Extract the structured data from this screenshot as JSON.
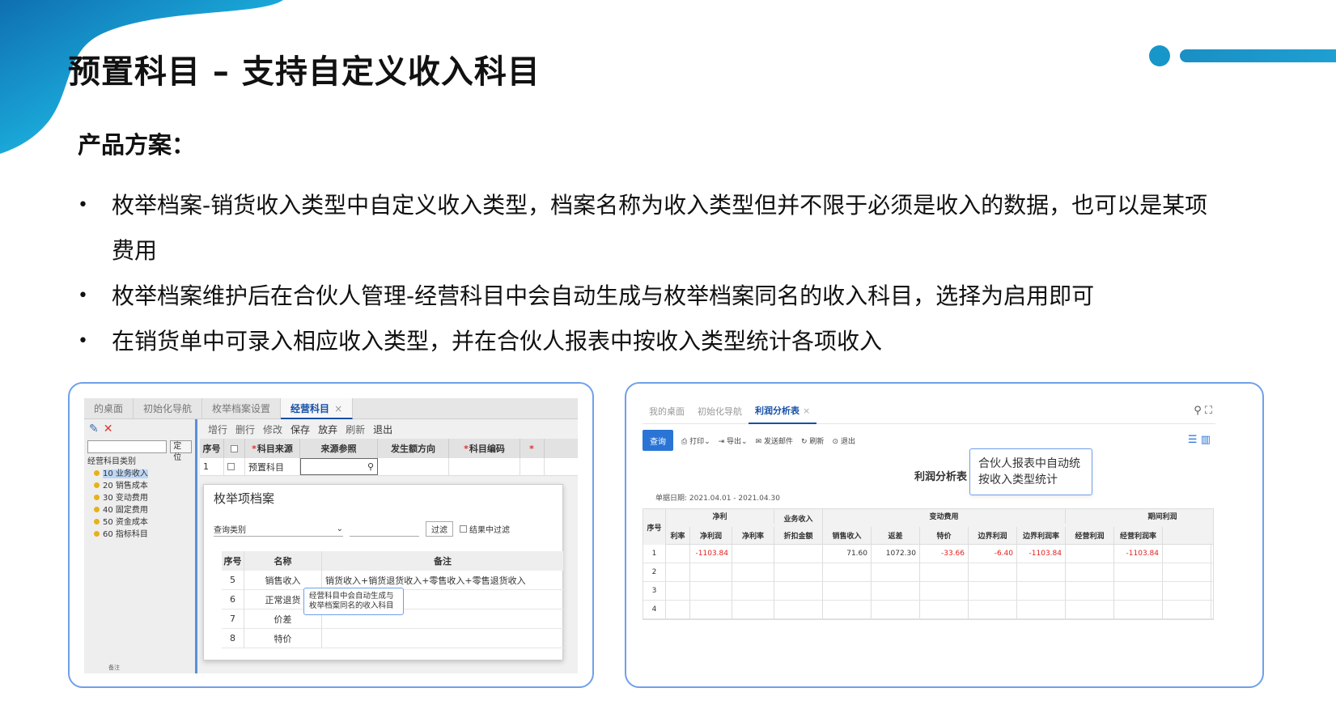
{
  "slide": {
    "title": "预置科目 – 支持自定义收入科目",
    "subtitle": "产品方案：",
    "bullet_symbol": "•",
    "bullets": [
      "枚举档案-销货收入类型中自定义收入类型，档案名称为收入类型但并不限于必须是收入的数据，也可以是某项费用",
      "枚举档案维护后在合伙人管理-经营科目中会自动生成与枚举档案同名的收入科目，选择为启用即可",
      "在销货单中可录入相应收入类型，并在合伙人报表中按收入类型统计各项收入"
    ],
    "colors": {
      "accent": "#1797c9",
      "frame_border": "#6fa0e8",
      "link_blue": "#1750a8",
      "negative": "#e02020"
    }
  },
  "left_app": {
    "tabs": [
      "的桌面",
      "初始化导航",
      "枚举档案设置",
      "经营科目"
    ],
    "close_symbol": "×",
    "sidebar": {
      "tool_icons": [
        "edit-icon",
        "delete-icon"
      ],
      "locate_button": "定位",
      "tree_root": "经营科目类别",
      "tree_items": [
        "10 业务收入",
        "20 销售成本",
        "30 变动费用",
        "40 固定费用",
        "50 资金成本",
        "60 指标科目"
      ],
      "status": "备注"
    },
    "toolbar": [
      "增行",
      "删行",
      "修改",
      "保存",
      "放弃",
      "刷新",
      "退出"
    ],
    "grid_headers": [
      "序号",
      "",
      "科目来源",
      "来源参照",
      "发生额方向",
      "科目编码",
      ""
    ],
    "required_mark": "*",
    "grid_row": {
      "seq": "1",
      "source": "预置科目"
    },
    "dialog": {
      "title": "枚举项档案",
      "query_label": "查询类别",
      "filter_button": "过滤",
      "filter_checkbox": "结果中过滤",
      "headers": [
        "序号",
        "名称",
        "备注"
      ],
      "rows": [
        {
          "seq": "5",
          "name": "销售收入",
          "remark": "销货收入+销货退货收入+零售收入+零售退货收入"
        },
        {
          "seq": "6",
          "name": "正常退货",
          "remark": ""
        },
        {
          "seq": "7",
          "name": "价差",
          "remark": ""
        },
        {
          "seq": "8",
          "name": "特价",
          "remark": ""
        }
      ]
    },
    "tooltip": "经营科目中会自动生成与枚举档案同名的收入科目"
  },
  "right_app": {
    "tabs": [
      "我的桌面",
      "初始化导航",
      "利润分析表"
    ],
    "close_symbol": "×",
    "toolbar": {
      "query_button": "查询",
      "items": [
        "打印",
        "导出",
        "发送邮件",
        "刷新",
        "退出"
      ]
    },
    "report_title": "利润分析表",
    "date_range": "单据日期: 2021.04.01 - 2021.04.30",
    "tooltip": "合伙人报表中自动统按收入类型统计",
    "group_headers": {
      "seq": "序号",
      "net": "净利",
      "biz": "业务收入",
      "variable": "变动费用",
      "margin": "期间利润"
    },
    "column_headers": [
      "利率",
      "净利润",
      "净利率",
      "折扣金额",
      "销售收入",
      "返差",
      "特价",
      "边界利润",
      "边界利润率",
      "经营利润",
      "经营利润率"
    ],
    "rows": [
      {
        "seq": "1",
        "net_profit": "-1103.84",
        "discount": "71.60",
        "sales": "1072.30",
        "rebate": "-33.66",
        "special": "-6.40",
        "margin_profit": "-1103.84",
        "op_profit": "-1103.84"
      },
      {
        "seq": "2"
      },
      {
        "seq": "3"
      },
      {
        "seq": "4"
      }
    ]
  }
}
